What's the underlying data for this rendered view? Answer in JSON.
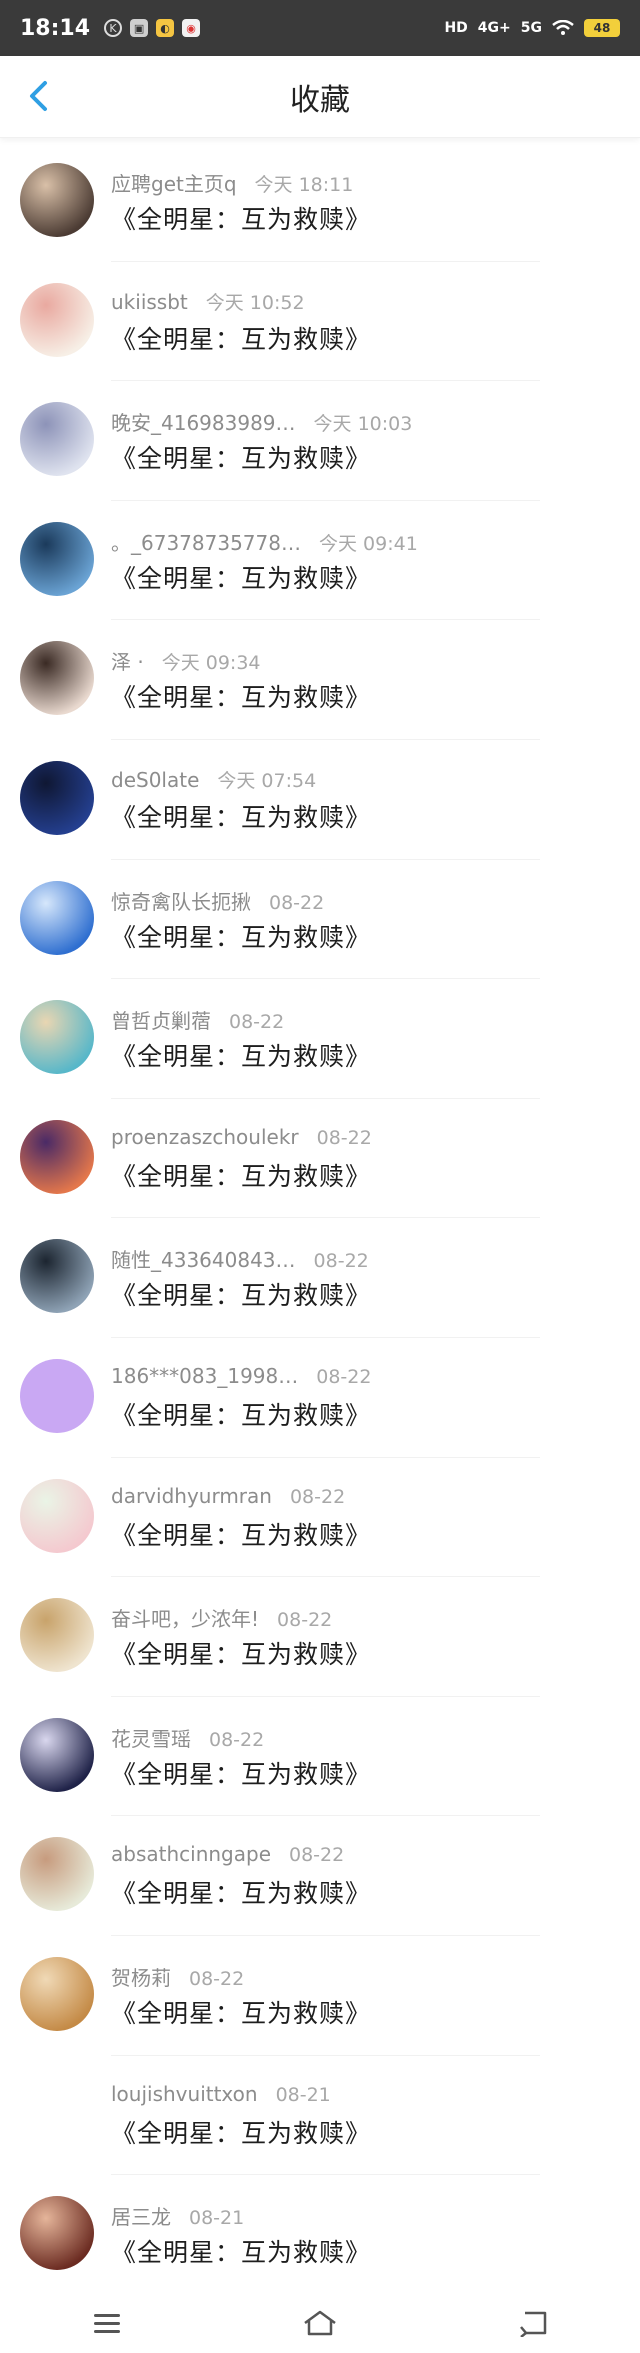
{
  "status_bar": {
    "time": "18:14",
    "signal_left": "HD",
    "net1": "4G+",
    "net2": "5G",
    "battery": "48"
  },
  "header": {
    "title": "收藏",
    "back_icon": "chevron-left-icon"
  },
  "items": [
    {
      "name": "应聘get主页q",
      "time": "今天 18:11",
      "title": "《全明星：互为救赎》",
      "avatar_colors": [
        "#4b3b33",
        "#d9c0a8"
      ]
    },
    {
      "name": "ukiissbt",
      "time": "今天 10:52",
      "title": "《全明星：互为救赎》",
      "avatar_colors": [
        "#f7efe6",
        "#e9a9a0"
      ]
    },
    {
      "name": "晚安_416983989…",
      "time": "今天 10:03",
      "title": "《全明星：互为救赎》",
      "avatar_colors": [
        "#dfe3ef",
        "#8d93b8"
      ]
    },
    {
      "name": "。_67378735778…",
      "time": "今天 09:41",
      "title": "《全明星：互为救赎》",
      "avatar_colors": [
        "#6aa3d4",
        "#1b3a5b"
      ]
    },
    {
      "name": "泽 ·",
      "time": "今天 09:34",
      "title": "《全明星：互为救赎》",
      "avatar_colors": [
        "#e9d9cf",
        "#3a2a24"
      ]
    },
    {
      "name": "deS0late",
      "time": "今天 07:54",
      "title": "《全明星：互为救赎》",
      "avatar_colors": [
        "#243f8f",
        "#0f1733"
      ]
    },
    {
      "name": "惊奇禽队长扼揪",
      "time": "08-22",
      "title": "《全明星：互为救赎》",
      "avatar_colors": [
        "#2f6fd0",
        "#d6e7fb"
      ]
    },
    {
      "name": "曾哲贞剿蓿",
      "time": "08-22",
      "title": "《全明星：互为救赎》",
      "avatar_colors": [
        "#57b7c9",
        "#e9d6b2"
      ]
    },
    {
      "name": "proenzaszchoulekr",
      "time": "08-22",
      "title": "《全明星：互为救赎》",
      "avatar_colors": [
        "#e4774b",
        "#4a2a66"
      ]
    },
    {
      "name": "随性_433640843…",
      "time": "08-22",
      "title": "《全明星：互为救赎》",
      "avatar_colors": [
        "#8fa3b6",
        "#1c2530"
      ]
    },
    {
      "name": "186***083_1998…",
      "time": "08-22",
      "title": "《全明星：互为救赎》",
      "avatar_colors": [
        "#c9a8f3",
        "#c9a8f3"
      ]
    },
    {
      "name": "darvidhyurmran",
      "time": "08-22",
      "title": "《全明星：互为救赎》",
      "avatar_colors": [
        "#f4c9cf",
        "#eaf4e6"
      ]
    },
    {
      "name": "奋斗吧，少浓年!",
      "time": "08-22",
      "title": "《全明星：互为救赎》",
      "avatar_colors": [
        "#efe4cf",
        "#c8a36b"
      ]
    },
    {
      "name": "花灵雪瑶",
      "time": "08-22",
      "title": "《全明星：互为救赎》",
      "avatar_colors": [
        "#1f2248",
        "#d9d7ee"
      ]
    },
    {
      "name": "absathcinngape",
      "time": "08-22",
      "title": "《全明星：互为救赎》",
      "avatar_colors": [
        "#e7ead9",
        "#c79b7e"
      ]
    },
    {
      "name": "贺杨莉",
      "time": "08-22",
      "title": "《全明星：互为救赎》",
      "avatar_colors": [
        "#c48a46",
        "#f0d9b6"
      ]
    },
    {
      "name": "loujishvuittxon",
      "time": "08-21",
      "title": "《全明星：互为救赎》",
      "avatar_colors": [
        "#ffffff",
        "#ffffff"
      ]
    },
    {
      "name": "居三龙",
      "time": "08-21",
      "title": "《全明星：互为救赎》",
      "avatar_colors": [
        "#6b2b21",
        "#e5b59a"
      ]
    }
  ],
  "bottom_nav": [
    "menu-icon",
    "home-icon",
    "back-icon"
  ]
}
